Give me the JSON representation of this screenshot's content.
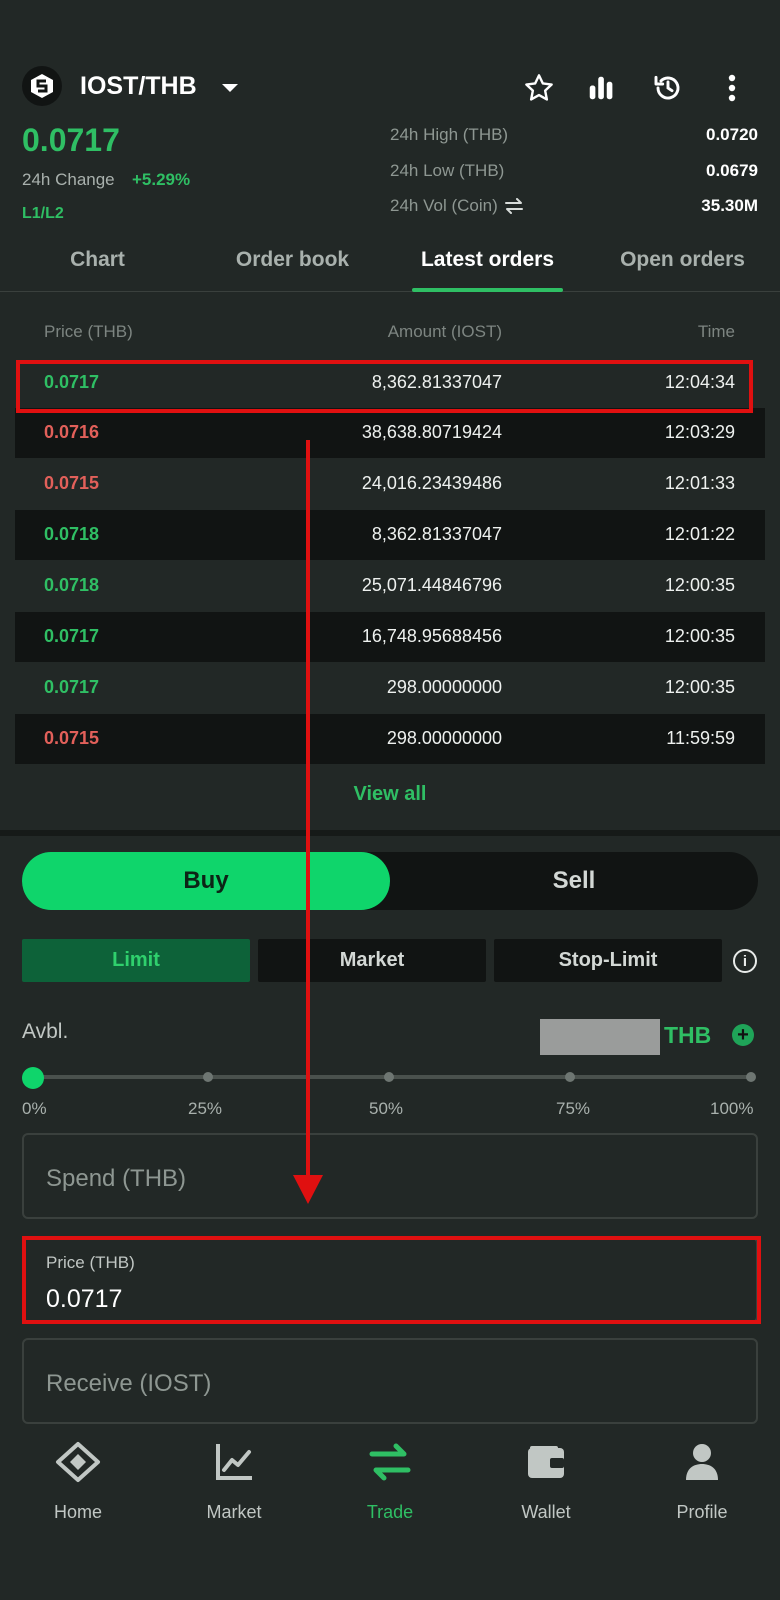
{
  "header": {
    "pair": "IOST/THB",
    "last_price": "0.0717",
    "change_label": "24h Change",
    "change_value": "+5.29%",
    "depth_label": "L1/L2",
    "stats": [
      {
        "label": "24h High (THB)",
        "value": "0.0720"
      },
      {
        "label": "24h Low (THB)",
        "value": "0.0679"
      },
      {
        "label": "24h Vol (Coin)",
        "value": "35.30M"
      }
    ],
    "icons": [
      "star-icon",
      "bar-chart-icon",
      "history-icon",
      "more-vertical-icon"
    ]
  },
  "tabs": [
    {
      "label": "Chart",
      "active": false
    },
    {
      "label": "Order book",
      "active": false
    },
    {
      "label": "Latest orders",
      "active": true
    },
    {
      "label": "Open orders",
      "active": false
    }
  ],
  "orders": {
    "columns": [
      "Price (THB)",
      "Amount (IOST)",
      "Time"
    ],
    "rows": [
      {
        "price": "0.0717",
        "amount": "8,362.81337047",
        "time": "12:04:34",
        "side": "buy"
      },
      {
        "price": "0.0716",
        "amount": "38,638.80719424",
        "time": "12:03:29",
        "side": "sell"
      },
      {
        "price": "0.0715",
        "amount": "24,016.23439486",
        "time": "12:01:33",
        "side": "sell"
      },
      {
        "price": "0.0718",
        "amount": "8,362.81337047",
        "time": "12:01:22",
        "side": "buy"
      },
      {
        "price": "0.0718",
        "amount": "25,071.44846796",
        "time": "12:00:35",
        "side": "buy"
      },
      {
        "price": "0.0717",
        "amount": "16,748.95688456",
        "time": "12:00:35",
        "side": "buy"
      },
      {
        "price": "0.0717",
        "amount": "298.00000000",
        "time": "12:00:35",
        "side": "buy"
      },
      {
        "price": "0.0715",
        "amount": "298.00000000",
        "time": "11:59:59",
        "side": "sell"
      }
    ],
    "view_all": "View all"
  },
  "trade": {
    "buy_label": "Buy",
    "sell_label": "Sell",
    "order_types": [
      {
        "label": "Limit",
        "active": true
      },
      {
        "label": "Market",
        "active": false
      },
      {
        "label": "Stop-Limit",
        "active": false
      }
    ],
    "info_icon": "i",
    "avbl_label": "Avbl.",
    "avbl_currency": "THB",
    "plus_icon": "+",
    "slider_value": 0,
    "slider_marks": [
      "0%",
      "25%",
      "50%",
      "75%",
      "100%"
    ],
    "spend_placeholder": "Spend (THB)",
    "price_label": "Price (THB)",
    "price_value": "0.0717",
    "receive_placeholder": "Receive (IOST)"
  },
  "nav": [
    {
      "label": "Home",
      "icon": "home-icon",
      "active": false
    },
    {
      "label": "Market",
      "icon": "market-icon",
      "active": false
    },
    {
      "label": "Trade",
      "icon": "trade-icon",
      "active": true
    },
    {
      "label": "Wallet",
      "icon": "wallet-icon",
      "active": false
    },
    {
      "label": "Profile",
      "icon": "profile-icon",
      "active": false
    }
  ],
  "colors": {
    "accent_green": "#2fbf64",
    "sell_red": "#e2605a",
    "annotation_red": "#e01010",
    "background": "#222826"
  }
}
